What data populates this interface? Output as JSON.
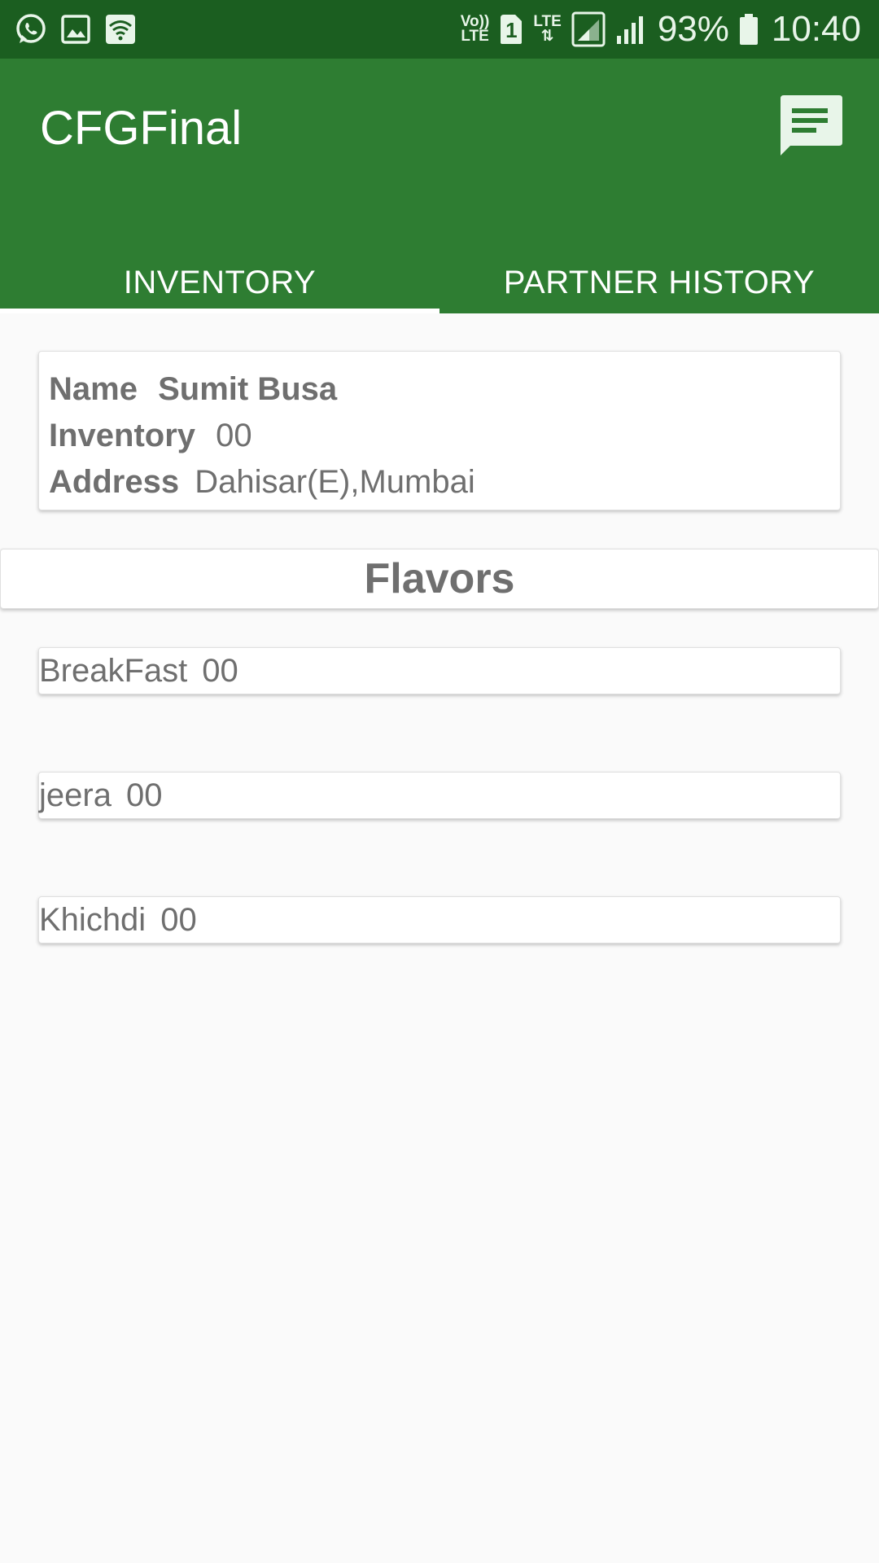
{
  "status_bar": {
    "icons_left": [
      "whatsapp-icon",
      "image-icon",
      "wifi-icon"
    ],
    "volte_top": "Vo))",
    "volte_bottom": "LTE",
    "sim": "1",
    "lte_label": "LTE",
    "lte_arrows": "⇅",
    "battery_percent": "93%",
    "time": "10:40"
  },
  "app_bar": {
    "title": "CFGFinal",
    "action_icon": "chat-icon",
    "accent_color": "#2e7d32",
    "status_color": "#1b5e20"
  },
  "tabs": [
    {
      "label": "INVENTORY",
      "active": true
    },
    {
      "label": "PARTNER HISTORY",
      "active": false
    }
  ],
  "info_card": {
    "name_label": "Name",
    "name_value": "Sumit Busa",
    "inventory_label": "Inventory",
    "inventory_value": "00",
    "address_label": "Address",
    "address_value": "Dahisar(E),Mumbai"
  },
  "flavors": {
    "header": "Flavors",
    "items": [
      {
        "name": "BreakFast",
        "count": "00"
      },
      {
        "name": "jeera",
        "count": "00"
      },
      {
        "name": "Khichdi",
        "count": "00"
      }
    ]
  }
}
